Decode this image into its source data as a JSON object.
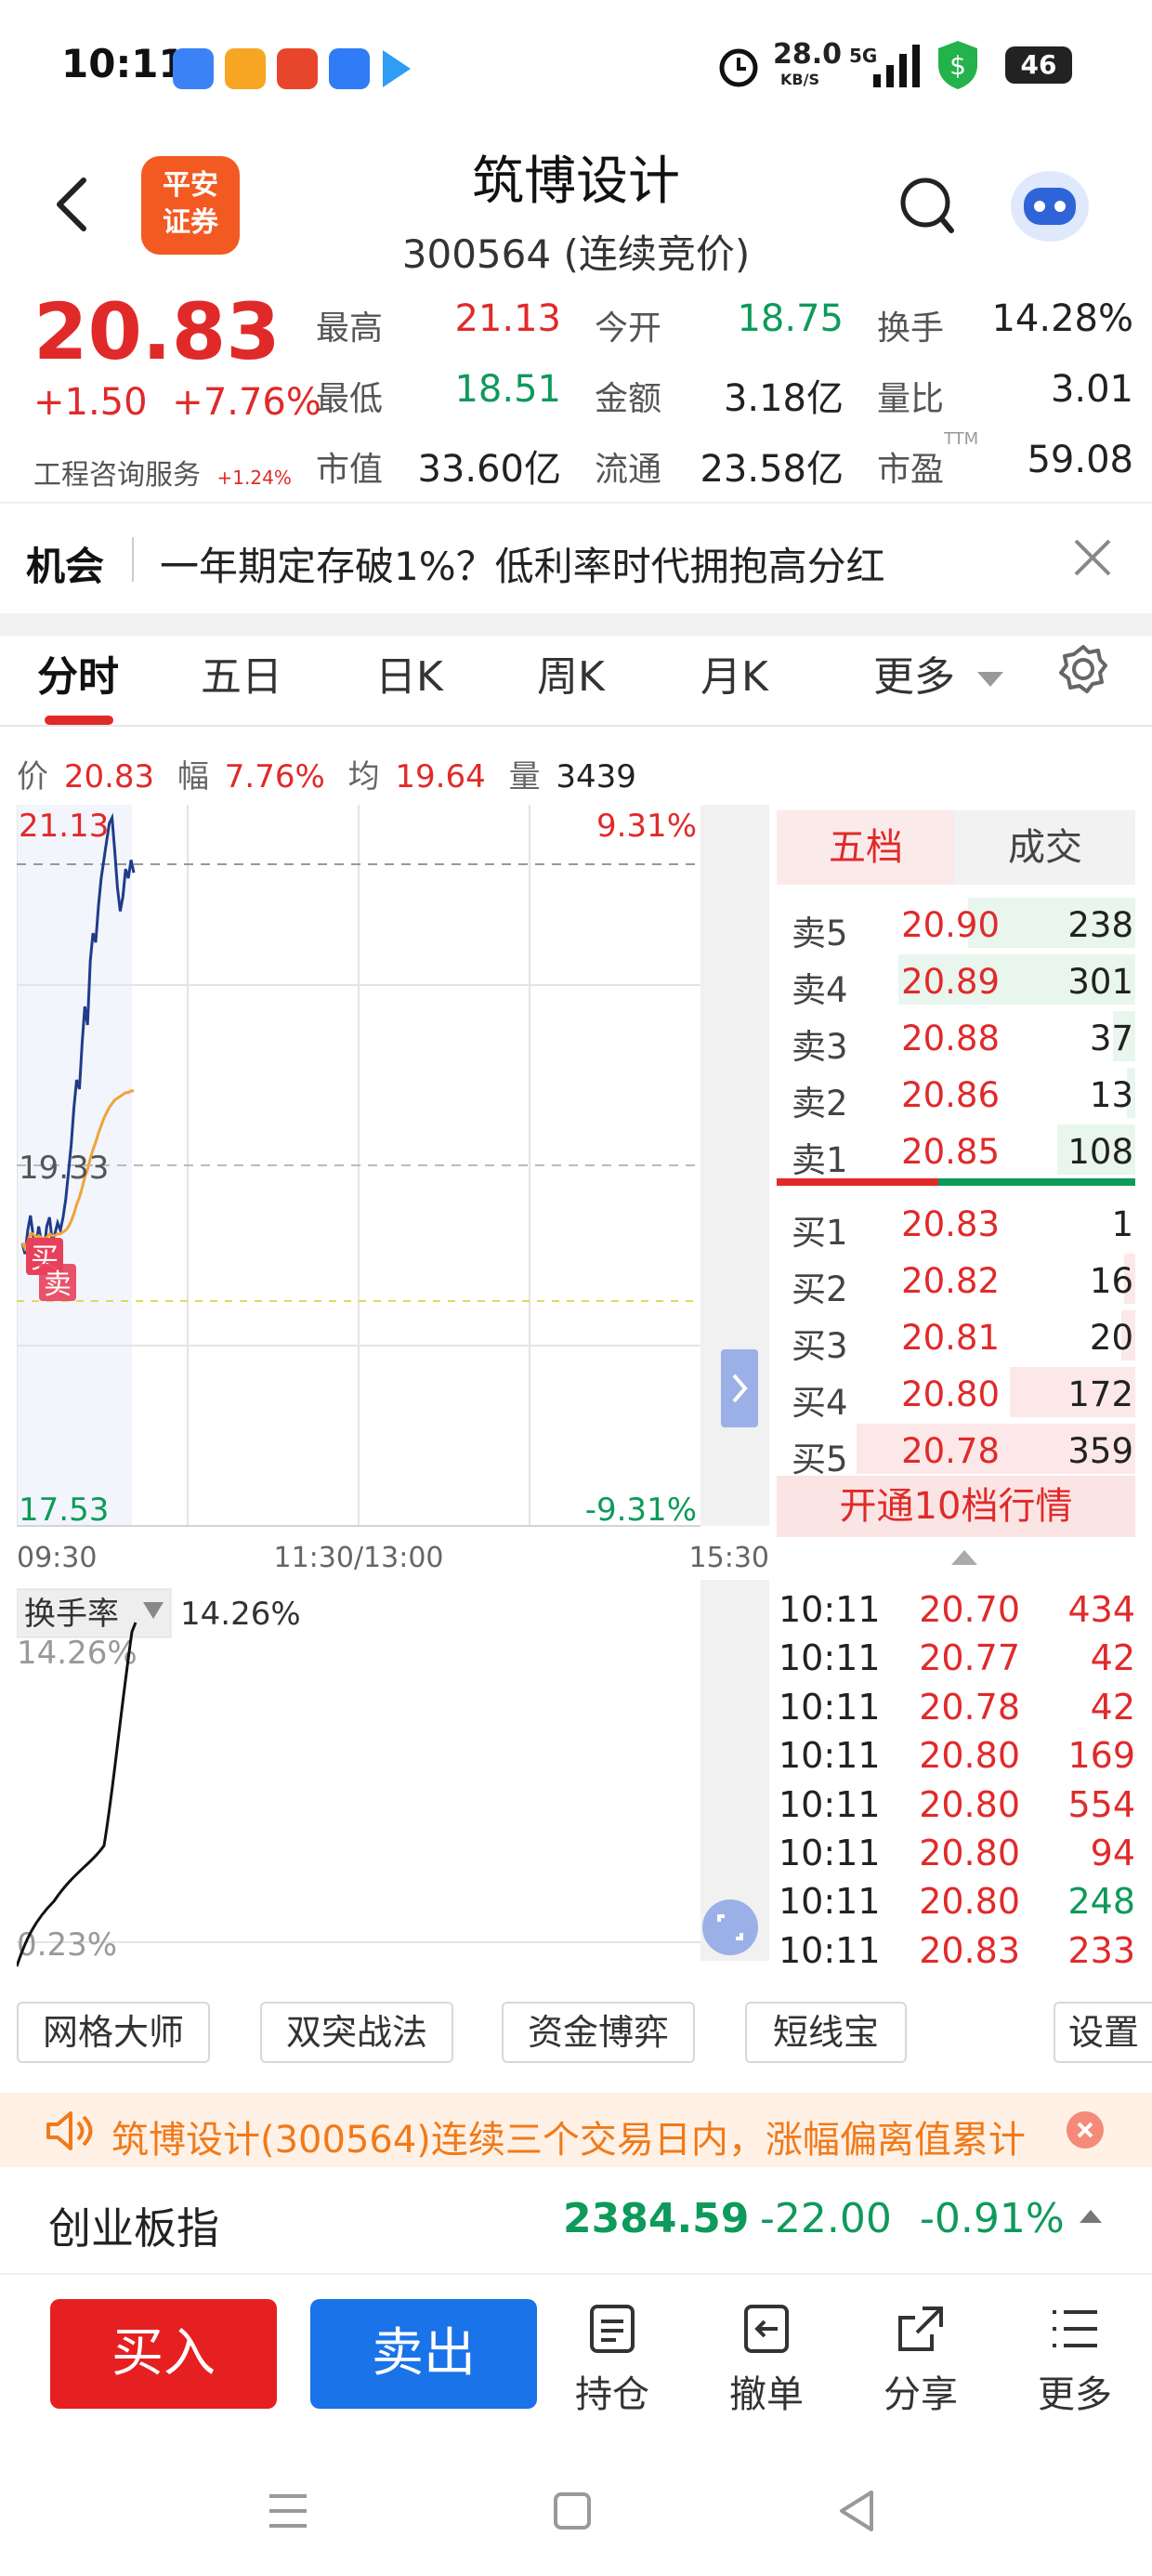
{
  "status_bar": {
    "time": "10:11",
    "net_speed": "28.0",
    "net_speed_unit": "KB/S",
    "signal": "5G",
    "battery": "46"
  },
  "header": {
    "logo_text_1": "平安",
    "logo_text_2": "证券",
    "stock_name": "筑博设计",
    "stock_sub": "300564 (连续竞价)",
    "search_icon": "search-icon",
    "robot_icon": "robot-avatar-icon"
  },
  "quote": {
    "price": "20.83",
    "change": "+1.50",
    "change_pct": "+7.76%",
    "industry": "工程咨询服务",
    "industry_pct": "+1.24%",
    "fields": [
      {
        "label": "最高",
        "value": "21.13",
        "color": "#e02a2a"
      },
      {
        "label": "今开",
        "value": "18.75",
        "color": "#0e9a5a"
      },
      {
        "label": "换手",
        "value": "14.28%",
        "color": "#222222"
      },
      {
        "label": "最低",
        "value": "18.51",
        "color": "#0e9a5a"
      },
      {
        "label": "金额",
        "value": "3.18亿",
        "color": "#222222"
      },
      {
        "label": "量比",
        "value": "3.01",
        "color": "#222222"
      },
      {
        "label": "市值",
        "value": "33.60亿",
        "color": "#222222"
      },
      {
        "label": "流通",
        "value": "23.58亿",
        "color": "#222222"
      },
      {
        "label": "市盈",
        "value": "59.08",
        "color": "#222222"
      }
    ],
    "pe_suffix": "TTM"
  },
  "opportunity": {
    "tag": "机会",
    "text": "一年期定存破1%？低利率时代拥抱高分红"
  },
  "tabs": [
    "分时",
    "五日",
    "日K",
    "周K",
    "月K",
    "更多"
  ],
  "summary": {
    "price_label": "价",
    "price": "20.83",
    "range_label": "幅",
    "range": "7.76%",
    "avg_label": "均",
    "avg": "19.64",
    "vol_label": "量",
    "vol": "3439"
  },
  "chart_data": {
    "type": "line",
    "title": "",
    "y_top_label": "21.13",
    "y_mid_label": "19.33",
    "y_bottom_label": "17.53",
    "pct_top_label": "9.31%",
    "pct_bottom_label": "-9.31%",
    "x_labels": [
      "09:30",
      "11:30/13:00",
      "15:30"
    ],
    "ylim": [
      17.53,
      21.13
    ],
    "prev_close": 19.33,
    "series": [
      {
        "x": [
          0,
          1,
          2,
          3,
          4,
          5,
          6,
          7,
          8,
          9,
          10,
          11,
          12,
          13,
          14,
          15,
          16,
          17,
          18,
          19,
          20,
          21,
          22,
          23,
          24,
          25,
          26,
          27,
          28,
          29,
          30,
          31,
          32,
          33,
          34,
          35,
          36,
          37,
          38,
          39,
          40,
          41
        ],
        "values": [
          18.81,
          18.75,
          18.88,
          18.96,
          18.85,
          18.79,
          18.9,
          18.82,
          18.76,
          18.9,
          18.95,
          18.82,
          18.86,
          18.92,
          18.88,
          18.95,
          19.05,
          19.2,
          19.35,
          19.55,
          19.7,
          19.65,
          19.9,
          20.1,
          20.0,
          20.35,
          20.5,
          20.45,
          20.65,
          20.8,
          20.9,
          21.0,
          21.1,
          21.13,
          20.95,
          20.75,
          20.62,
          20.7,
          20.85,
          20.8,
          20.9,
          20.83
        ]
      },
      {
        "x": [
          0,
          1,
          2,
          3,
          4,
          5,
          6,
          7,
          8,
          9,
          10,
          11,
          12,
          13,
          14,
          15,
          16,
          17,
          18,
          19,
          20,
          21,
          22,
          23,
          24,
          25,
          26,
          27,
          28,
          29,
          30,
          31,
          32,
          33,
          34,
          35,
          36,
          37,
          38,
          39,
          40,
          41
        ],
        "values": [
          18.81,
          18.78,
          18.82,
          18.86,
          18.86,
          18.84,
          18.85,
          18.84,
          18.83,
          18.84,
          18.86,
          18.85,
          18.85,
          18.86,
          18.86,
          18.87,
          18.88,
          18.9,
          18.93,
          18.97,
          19.02,
          19.06,
          19.11,
          19.17,
          19.21,
          19.27,
          19.32,
          19.36,
          19.41,
          19.45,
          19.49,
          19.52,
          19.55,
          19.57,
          19.59,
          19.6,
          19.61,
          19.62,
          19.63,
          19.63,
          19.64,
          19.64
        ]
      }
    ],
    "colors": {
      "price": "#1f3c8a",
      "avg": "#f0a33a",
      "grid": "#dddddd"
    }
  },
  "markers": {
    "buy": "买",
    "sell": "卖"
  },
  "order_book": {
    "tab_level": "五档",
    "tab_trades": "成交",
    "asks": [
      {
        "label": "卖5",
        "price": "20.90",
        "vol": "238",
        "bar": 0.6
      },
      {
        "label": "卖4",
        "price": "20.89",
        "vol": "301",
        "bar": 0.85
      },
      {
        "label": "卖3",
        "price": "20.88",
        "vol": "37",
        "bar": 0.08
      },
      {
        "label": "卖2",
        "price": "20.86",
        "vol": "13",
        "bar": 0.03
      },
      {
        "label": "卖1",
        "price": "20.85",
        "vol": "108",
        "bar": 0.28
      }
    ],
    "bids": [
      {
        "label": "买1",
        "price": "20.83",
        "vol": "1",
        "bar": 0.0
      },
      {
        "label": "买2",
        "price": "20.82",
        "vol": "16",
        "bar": 0.04
      },
      {
        "label": "买3",
        "price": "20.81",
        "vol": "20",
        "bar": 0.05
      },
      {
        "label": "买4",
        "price": "20.80",
        "vol": "172",
        "bar": 0.45
      },
      {
        "label": "买5",
        "price": "20.78",
        "vol": "359",
        "bar": 1.0
      }
    ],
    "upgrade": "开通10档行情"
  },
  "turnover": {
    "label": "换手率",
    "value": "14.26%",
    "top_label": "14.26%",
    "bottom_label": "0.23%"
  },
  "trades": [
    {
      "time": "10:11",
      "price": "20.70",
      "vol": "434",
      "vol_color": "#e02a2a"
    },
    {
      "time": "10:11",
      "price": "20.77",
      "vol": "42",
      "vol_color": "#e02a2a"
    },
    {
      "time": "10:11",
      "price": "20.78",
      "vol": "42",
      "vol_color": "#e02a2a"
    },
    {
      "time": "10:11",
      "price": "20.80",
      "vol": "169",
      "vol_color": "#e02a2a"
    },
    {
      "time": "10:11",
      "price": "20.80",
      "vol": "554",
      "vol_color": "#e02a2a"
    },
    {
      "time": "10:11",
      "price": "20.80",
      "vol": "94",
      "vol_color": "#e02a2a"
    },
    {
      "time": "10:11",
      "price": "20.80",
      "vol": "248",
      "vol_color": "#0e9a5a"
    },
    {
      "time": "10:11",
      "price": "20.83",
      "vol": "233",
      "vol_color": "#e02a2a"
    }
  ],
  "tools": [
    "网格大师",
    "双突战法",
    "资金博弈",
    "短线宝",
    "设置"
  ],
  "notice": "筑博设计(300564)连续三个交易日内，涨幅偏离值累计",
  "index": {
    "name": "创业板指",
    "value": "2384.59",
    "change": "-22.00",
    "pct": "-0.91%"
  },
  "actions": {
    "buy": "买入",
    "sell": "卖出",
    "items": [
      "持仓",
      "撤单",
      "分享",
      "更多"
    ]
  }
}
